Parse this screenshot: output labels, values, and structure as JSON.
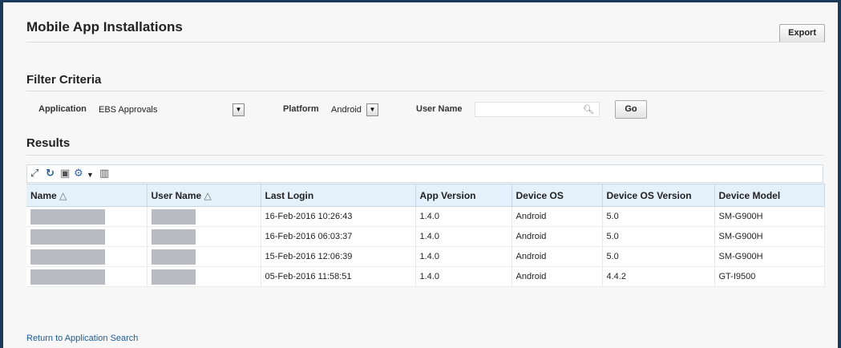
{
  "header": {
    "title": "Mobile App Installations",
    "export_label": "Export"
  },
  "filter": {
    "title": "Filter Criteria",
    "application_label": "Application",
    "application_value": "EBS Approvals",
    "platform_label": "Platform",
    "platform_value": "Android",
    "user_name_label": "User Name",
    "user_name_value": "",
    "go_label": "Go"
  },
  "results": {
    "title": "Results",
    "columns": [
      "Name",
      "User Name",
      "Last Login",
      "App Version",
      "Device OS",
      "Device OS Version",
      "Device Model"
    ],
    "sort_indicator": "△",
    "rows": [
      {
        "name": "",
        "user_name": "",
        "last_login": "16-Feb-2016 10:26:43",
        "app_version": "1.4.0",
        "device_os": "Android",
        "os_version": "5.0",
        "model": "SM-G900H"
      },
      {
        "name": "",
        "user_name": "",
        "last_login": "16-Feb-2016 06:03:37",
        "app_version": "1.4.0",
        "device_os": "Android",
        "os_version": "5.0",
        "model": "SM-G900H"
      },
      {
        "name": "",
        "user_name": "",
        "last_login": "15-Feb-2016 12:06:39",
        "app_version": "1.4.0",
        "device_os": "Android",
        "os_version": "5.0",
        "model": "SM-G900H"
      },
      {
        "name": "",
        "user_name": "",
        "last_login": "05-Feb-2016 11:58:51",
        "app_version": "1.4.0",
        "device_os": "Android",
        "os_version": "4.4.2",
        "model": "GT-I9500"
      }
    ]
  },
  "footer": {
    "return_link": "Return to Application Search"
  },
  "icons": [
    "detach-icon",
    "refresh-icon",
    "freeze-icon",
    "gear-icon",
    "dropdown-caret-icon",
    "columns-icon",
    "search-icon"
  ],
  "colors": {
    "frame": "#1c3b5a",
    "header_bg": "#e4f1fb",
    "link": "#1a5da3"
  }
}
